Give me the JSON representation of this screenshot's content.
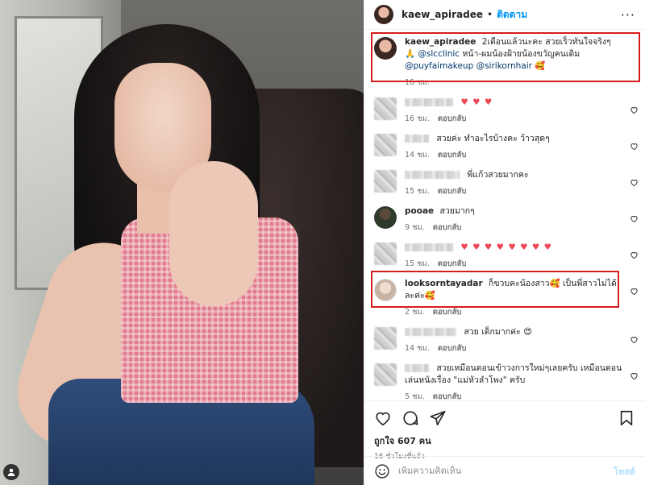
{
  "post": {
    "owner": "kaew_apiradee",
    "header_dot": "•",
    "follow_label": "ติดตาม",
    "more_label": "···"
  },
  "caption": {
    "username": "kaew_apiradee",
    "text_1": "2เดือนแล้วนะคะ สวยเร็วทันใจจริงๆ 🙏",
    "mention_1": "@slcclinic",
    "text_2": "หน้า-ผมน้องฝ้ายน้องขวัญคนเดิม",
    "mention_2": "@puyfaimakeup",
    "mention_3": "@sirikornhair",
    "text_3": "🥰",
    "time": "16 ชม."
  },
  "comments": [
    {
      "username": "",
      "text": "♥ ♥ ♥",
      "time": "16 ชม.",
      "reply": "ตอบกลับ",
      "hearts": true
    },
    {
      "username": "",
      "text": "สวยค่ะ ทำอะไรบ้างคะ ว้าวสุดๆ",
      "time": "14 ชม.",
      "reply": "ตอบกลับ"
    },
    {
      "username": "",
      "text": "พี่แก้วสวยมากคะ",
      "time": "15 ชม.",
      "reply": "ตอบกลับ"
    },
    {
      "username": "pooae",
      "text": "สวยมากๆ",
      "time": "9 ชม.",
      "reply": "ตอบกลับ"
    },
    {
      "username": "",
      "text": "♥ ♥ ♥ ♥ ♥ ♥ ♥ ♥",
      "time": "15 ชม.",
      "reply": "ตอบกลับ",
      "hearts": true
    },
    {
      "username": "looksorntayadar",
      "text": "ก็ขวบคะน้องสาว🥰 เป็นพี่สาวไม่ได้ละค่ะ🥰",
      "time": "2 ชม.",
      "reply": "ตอบกลับ"
    },
    {
      "username": "",
      "text": "สวย เด็กมากค่ะ 😍",
      "time": "14 ชม.",
      "reply": "ตอบกลับ"
    },
    {
      "username": "",
      "text": "สวยเหมือนตอนเข้าวงการใหม่ๆเลยครับ เหมือนตอนเล่นหนังเรื่อง \"แม่หัวลำโพง\" ครับ",
      "time": "5 ชม.",
      "reply": "ตอบกลับ"
    }
  ],
  "likes": {
    "text": "ถูกใจ 607 คน",
    "time_ago": "16 ชั่วโมงที่แล้ว"
  },
  "add_comment": {
    "placeholder": "เพิ่มความคิดเห็น",
    "post_label": "โพสต์"
  },
  "colors": {
    "link": "#0095f6",
    "mention": "#00376b",
    "heart": "#ed4956",
    "highlight": "#d61d1d"
  }
}
